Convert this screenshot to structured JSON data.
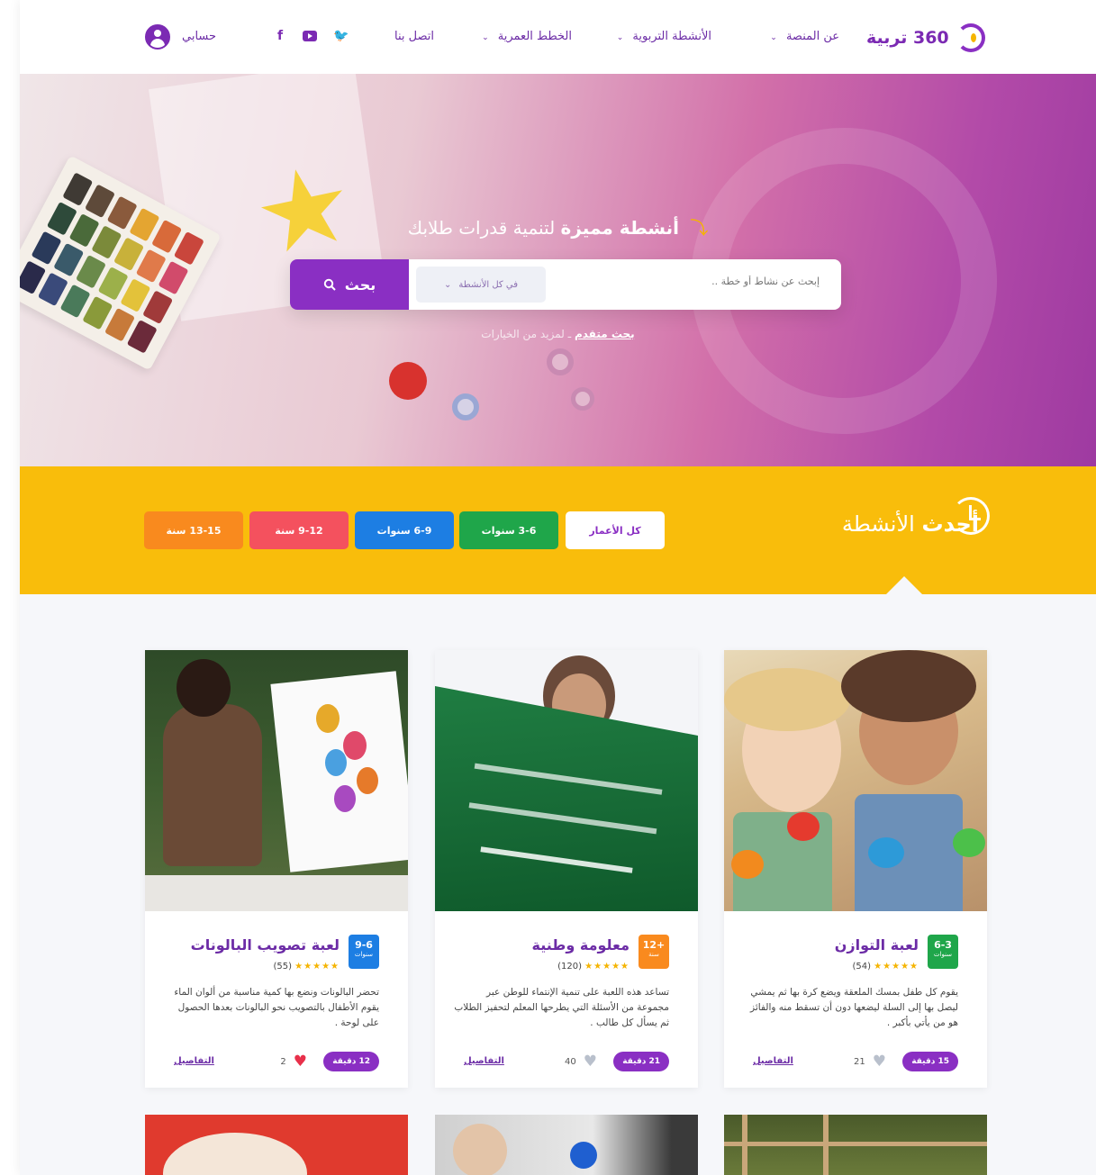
{
  "nav": {
    "logo_text": "360 تربية",
    "items": [
      {
        "label": "عن المنصة",
        "has_dropdown": true
      },
      {
        "label": "الأنشطة التربوية",
        "has_dropdown": true
      },
      {
        "label": "الخطط العمرية",
        "has_dropdown": true
      },
      {
        "label": "اتصل بنا",
        "has_dropdown": false
      }
    ],
    "social": [
      "twitter-icon",
      "youtube-icon",
      "facebook-icon"
    ],
    "facebook_glyph": "f",
    "twitter_glyph": "🐦",
    "account_label": "حسابي"
  },
  "hero": {
    "title_bold": "أنشطة مميزة",
    "title_rest": "لتنمية قدرات طلابك",
    "search_placeholder": "إبحث عن نشاط أو خطة ..",
    "select_value": "في كل الأنشطة",
    "search_button": "بحث",
    "advanced_link": "بحث متقدم",
    "advanced_rest": "لمزيد من الخيارات"
  },
  "latest": {
    "title_bold": "أحدث",
    "title_rest": "الأنشطة",
    "filters": [
      {
        "label": "كل الأعمار",
        "color": "#ffffff",
        "text_color": "#8a2fc3"
      },
      {
        "label": "3-6 سنوات",
        "color": "#1fa64a",
        "text_color": "#ffffff"
      },
      {
        "label": "6-9 سنوات",
        "color": "#1d7ee3",
        "text_color": "#ffffff"
      },
      {
        "label": "9-12 سنة",
        "color": "#f4515e",
        "text_color": "#ffffff"
      },
      {
        "label": "13-15 سنة",
        "color": "#f98a1e",
        "text_color": "#ffffff"
      }
    ]
  },
  "cards": [
    {
      "title": "لعبة التوازن",
      "age": "6-3",
      "age_unit": "سنوات",
      "badge_color": "#1fa64a",
      "rating_count": "(54)",
      "desc": "يقوم كل طفل بمسك الملعقة ويضع كرة بها ثم يمشي ليصل بها إلى السلة ليضعها دون أن تسقط منه والفائز هو من يأتي بأكبر .",
      "time": "15 دقيقة",
      "likes": "21",
      "liked": false,
      "details": "التفاصيل"
    },
    {
      "title": "معلومة وطنية",
      "age": "+12",
      "age_unit": "سنة",
      "badge_color": "#f98a1e",
      "rating_count": "(120)",
      "desc": "تساعد هذه اللعبة على تنمية الإنتماء للوطن عبر مجموعة من الأسئلة التي يطرحها المعلم لتحفيز الطلاب ثم يسأل كل طالب .",
      "time": "21 دقيقة",
      "likes": "40",
      "liked": false,
      "details": "التفاصيل"
    },
    {
      "title": "لعبة تصويب البالونات",
      "age": "9-6",
      "age_unit": "سنوات",
      "badge_color": "#1d7ee3",
      "rating_count": "(55)",
      "desc": "تحضر البالونات ونضع بها كمية مناسبة من ألوان الماء يقوم الأطفال بالتصويب نحو البالونات بعدها الحصول على لوحة .",
      "time": "12 دقيقة",
      "likes": "2",
      "liked": true,
      "details": "التفاصيل"
    }
  ],
  "stars_glyph": "★★★★★",
  "colors": {
    "brand_purple": "#8a2fc3",
    "yellow": "#f9bd0b",
    "heart_red": "#e8304a",
    "heart_grey": "#b9c0cc"
  }
}
